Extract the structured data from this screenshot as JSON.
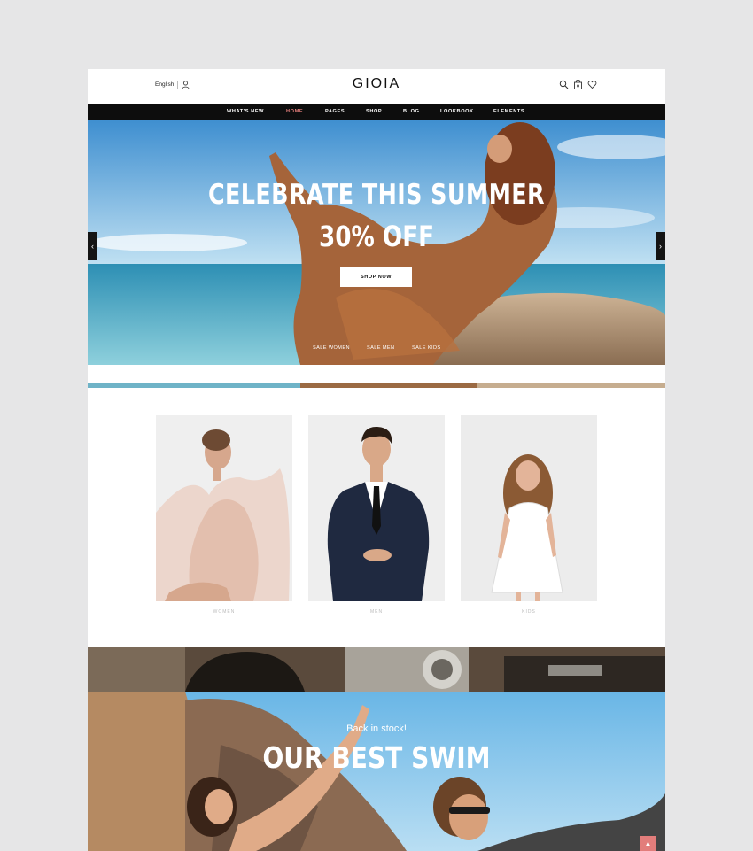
{
  "header": {
    "language": "English",
    "logo": "GIOIA"
  },
  "nav": {
    "items": [
      "WHAT'S NEW",
      "HOME",
      "PAGES",
      "SHOP",
      "BLOG",
      "LOOKBOOK",
      "ELEMENTS"
    ],
    "active_index": 1
  },
  "hero": {
    "title": "CELEBRATE THIS SUMMER",
    "subtitle": "30% OFF",
    "button": "SHOP NOW",
    "prev": "‹",
    "next": "›",
    "links": [
      "SALE WOMEN",
      "SALE MEN",
      "SALE KIDS"
    ]
  },
  "categories": [
    "WOMEN",
    "MEN",
    "KIDS"
  ],
  "promo": {
    "pretitle": "Back in stock!",
    "title": "OUR BEST SWIM",
    "scroll_top": "▲"
  },
  "colors": {
    "nav_bg": "#0d0d0d",
    "accent": "#e27d7b",
    "page_bg": "#e6e6e7"
  },
  "icons": [
    "user-icon",
    "search-icon",
    "bag-icon",
    "wishlist-icon",
    "arrow-left-icon",
    "arrow-right-icon",
    "arrow-up-icon"
  ]
}
